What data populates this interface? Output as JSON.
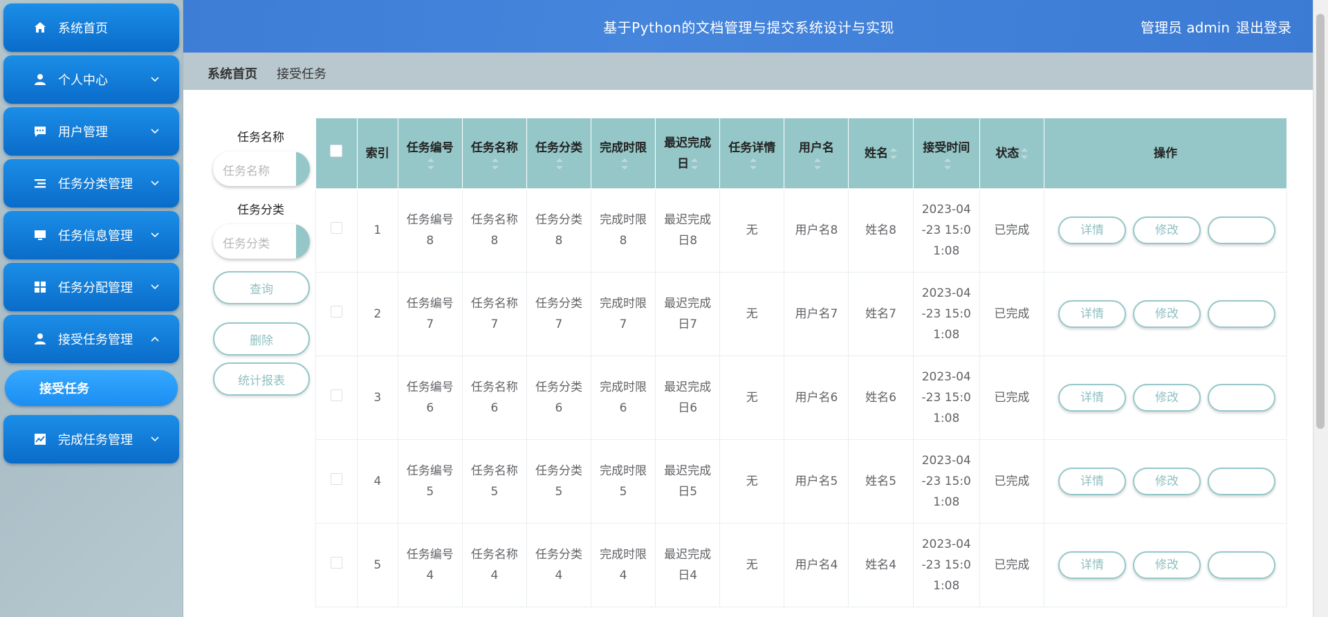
{
  "header": {
    "title": "基于Python的文档管理与提交系统设计与实现",
    "user": "管理员 admin",
    "logout": "退出登录"
  },
  "sidebar": {
    "items": [
      {
        "label": "系统首页",
        "icon": "home-icon",
        "chevron": ""
      },
      {
        "label": "个人中心",
        "icon": "person-icon",
        "chevron": "down"
      },
      {
        "label": "用户管理",
        "icon": "chat-icon",
        "chevron": "down"
      },
      {
        "label": "任务分类管理",
        "icon": "list-icon",
        "chevron": "down"
      },
      {
        "label": "任务信息管理",
        "icon": "monitor-icon",
        "chevron": "down"
      },
      {
        "label": "任务分配管理",
        "icon": "grid-icon",
        "chevron": "down"
      },
      {
        "label": "接受任务管理",
        "icon": "person-icon",
        "chevron": "up"
      },
      {
        "label": "完成任务管理",
        "icon": "chart-icon",
        "chevron": "down"
      }
    ],
    "submenu": {
      "label": "接受任务"
    }
  },
  "breadcrumb": {
    "home": "系统首页",
    "current": "接受任务"
  },
  "search": {
    "name_label": "任务名称",
    "name_placeholder": "任务名称",
    "category_label": "任务分类",
    "category_placeholder": "任务分类",
    "query_button": "查询",
    "delete_button": "删除",
    "report_button": "统计报表"
  },
  "table": {
    "headers": {
      "index": "索引",
      "task_no": "任务编号",
      "task_name": "任务名称",
      "task_category": "任务分类",
      "deadline": "完成时限",
      "latest_date_a": "最迟完成",
      "latest_date_b": "日",
      "detail": "任务详情",
      "username": "用户名",
      "name": "姓名",
      "accept_time": "接受时间",
      "status": "状态",
      "actions": "操作"
    },
    "rows": [
      {
        "index": "1",
        "task_no_a": "任务编号",
        "task_no_b": "8",
        "task_name_a": "任务名称",
        "task_name_b": "8",
        "category_a": "任务分类",
        "category_b": "8",
        "deadline_a": "完成时限",
        "deadline_b": "8",
        "latest_a": "最迟完成",
        "latest_b": "日8",
        "detail": "无",
        "username": "用户名8",
        "name": "姓名8",
        "time_a": "2023-04",
        "time_b": "-23 15:0",
        "time_c": "1:08",
        "status": "已完成"
      },
      {
        "index": "2",
        "task_no_a": "任务编号",
        "task_no_b": "7",
        "task_name_a": "任务名称",
        "task_name_b": "7",
        "category_a": "任务分类",
        "category_b": "7",
        "deadline_a": "完成时限",
        "deadline_b": "7",
        "latest_a": "最迟完成",
        "latest_b": "日7",
        "detail": "无",
        "username": "用户名7",
        "name": "姓名7",
        "time_a": "2023-04",
        "time_b": "-23 15:0",
        "time_c": "1:08",
        "status": "已完成"
      },
      {
        "index": "3",
        "task_no_a": "任务编号",
        "task_no_b": "6",
        "task_name_a": "任务名称",
        "task_name_b": "6",
        "category_a": "任务分类",
        "category_b": "6",
        "deadline_a": "完成时限",
        "deadline_b": "6",
        "latest_a": "最迟完成",
        "latest_b": "日6",
        "detail": "无",
        "username": "用户名6",
        "name": "姓名6",
        "time_a": "2023-04",
        "time_b": "-23 15:0",
        "time_c": "1:08",
        "status": "已完成"
      },
      {
        "index": "4",
        "task_no_a": "任务编号",
        "task_no_b": "5",
        "task_name_a": "任务名称",
        "task_name_b": "5",
        "category_a": "任务分类",
        "category_b": "5",
        "deadline_a": "完成时限",
        "deadline_b": "5",
        "latest_a": "最迟完成",
        "latest_b": "日5",
        "detail": "无",
        "username": "用户名5",
        "name": "姓名5",
        "time_a": "2023-04",
        "time_b": "-23 15:0",
        "time_c": "1:08",
        "status": "已完成"
      },
      {
        "index": "5",
        "task_no_a": "任务编号",
        "task_no_b": "4",
        "task_name_a": "任务名称",
        "task_name_b": "4",
        "category_a": "任务分类",
        "category_b": "4",
        "deadline_a": "完成时限",
        "deadline_b": "4",
        "latest_a": "最迟完成",
        "latest_b": "日4",
        "detail": "无",
        "username": "用户名4",
        "name": "姓名4",
        "time_a": "2023-04",
        "time_b": "-23 15:0",
        "time_c": "1:08",
        "status": "已完成"
      }
    ],
    "row_actions": {
      "detail": "详情",
      "edit": "修改"
    }
  }
}
